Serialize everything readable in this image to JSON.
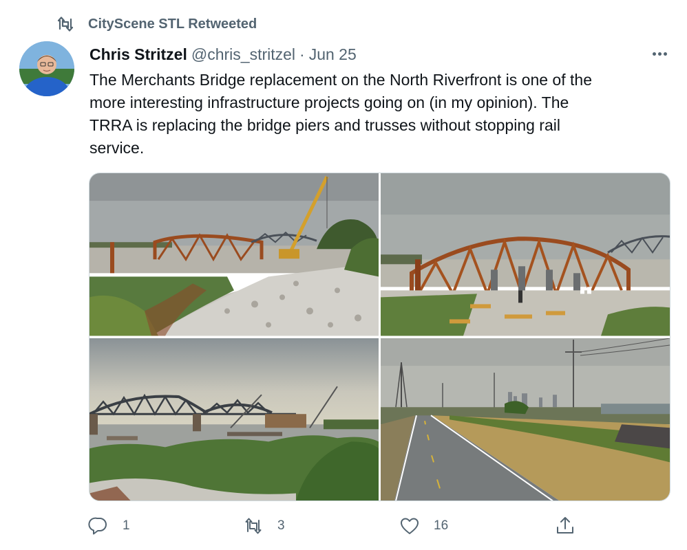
{
  "retweet_banner": {
    "icon": "retweet-icon",
    "text": "CityScene STL Retweeted"
  },
  "tweet": {
    "author": {
      "display_name": "Chris Stritzel",
      "handle": "@chris_stritzel",
      "separator": "·",
      "date": "Jun 25",
      "avatar_icon": "avatar"
    },
    "text_lines": [
      "The Merchants Bridge replacement on the North Riverfront is one of the",
      "more interesting infrastructure projects going on (in my opinion). The",
      "TRRA is replacing the bridge piers and trusses without stopping rail",
      "service."
    ],
    "more_icon": "more-horizontal-icon",
    "media": [
      {
        "icon": "photo"
      },
      {
        "icon": "photo"
      },
      {
        "icon": "photo"
      },
      {
        "icon": "photo"
      }
    ],
    "actions": {
      "reply": {
        "icon": "reply-icon",
        "count": "1"
      },
      "retweet": {
        "icon": "retweet-icon",
        "count": "3"
      },
      "like": {
        "icon": "heart-icon",
        "count": "16"
      },
      "share": {
        "icon": "share-icon"
      }
    }
  },
  "colors": {
    "text_primary": "#0f1419",
    "text_secondary": "#536471",
    "border": "#cfd9de",
    "bridge_rust": "#9a4b1f",
    "bridge_steel": "#4a5058"
  }
}
